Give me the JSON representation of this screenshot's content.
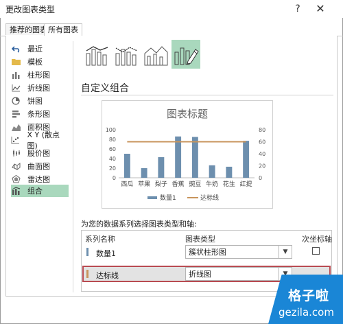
{
  "window": {
    "title": "更改图表类型",
    "help": "?",
    "close": "✕"
  },
  "tabs": [
    {
      "label": "推荐的图表"
    },
    {
      "label": "所有图表"
    }
  ],
  "sidebar": {
    "items": [
      {
        "label": "最近",
        "icon": "undo-icon"
      },
      {
        "label": "模板",
        "icon": "folder-icon"
      },
      {
        "label": "柱形图",
        "icon": "column-chart-icon"
      },
      {
        "label": "折线图",
        "icon": "line-chart-icon"
      },
      {
        "label": "饼图",
        "icon": "pie-chart-icon"
      },
      {
        "label": "条形图",
        "icon": "bar-chart-icon"
      },
      {
        "label": "面积图",
        "icon": "area-chart-icon"
      },
      {
        "label": "X Y (散点图)",
        "icon": "scatter-chart-icon"
      },
      {
        "label": "股价图",
        "icon": "stock-chart-icon"
      },
      {
        "label": "曲面图",
        "icon": "surface-chart-icon"
      },
      {
        "label": "雷达图",
        "icon": "radar-chart-icon"
      },
      {
        "label": "组合",
        "icon": "combo-chart-icon"
      }
    ],
    "selected": "组合"
  },
  "combo_section": {
    "title": "自定义组合"
  },
  "chart_data": {
    "type": "bar",
    "title": "图表标题",
    "categories": [
      "西瓜",
      "苹果",
      "梨子",
      "香蕉",
      "豌豆",
      "牛奶",
      "花生",
      "红提"
    ],
    "series": [
      {
        "name": "数量1",
        "type": "bar",
        "axis": "left",
        "values": [
          50,
          20,
          43,
          86,
          85,
          26,
          23,
          77
        ]
      },
      {
        "name": "达标线",
        "type": "line",
        "axis": "right",
        "values": [
          60,
          60,
          60,
          60,
          60,
          60,
          60,
          60
        ]
      }
    ],
    "y_left": {
      "ticks": [
        "0",
        "20",
        "40",
        "60",
        "80",
        "100"
      ],
      "ylim": [
        0,
        100
      ]
    },
    "y_right": {
      "ticks": [
        "0",
        "20",
        "40",
        "60",
        "80"
      ],
      "ylim": [
        0,
        80
      ]
    },
    "legend_position": "bottom",
    "grid": false,
    "colors": {
      "bar": "#6d8fae",
      "line": "#c8945c"
    }
  },
  "series_table": {
    "instruction": "为您的数据系列选择图表类型和轴:",
    "headers": {
      "name": "系列名称",
      "type": "图表类型",
      "secondary": "次坐标轴"
    },
    "rows": [
      {
        "name": "数量1",
        "type": "簇状柱形图",
        "secondary": false,
        "color": "#6d8fae"
      },
      {
        "name": "达标线",
        "type": "折线图",
        "secondary": false,
        "color": "#c8945c"
      }
    ]
  },
  "watermark": {
    "line1": "格子啦",
    "line2": "gezila.com"
  }
}
